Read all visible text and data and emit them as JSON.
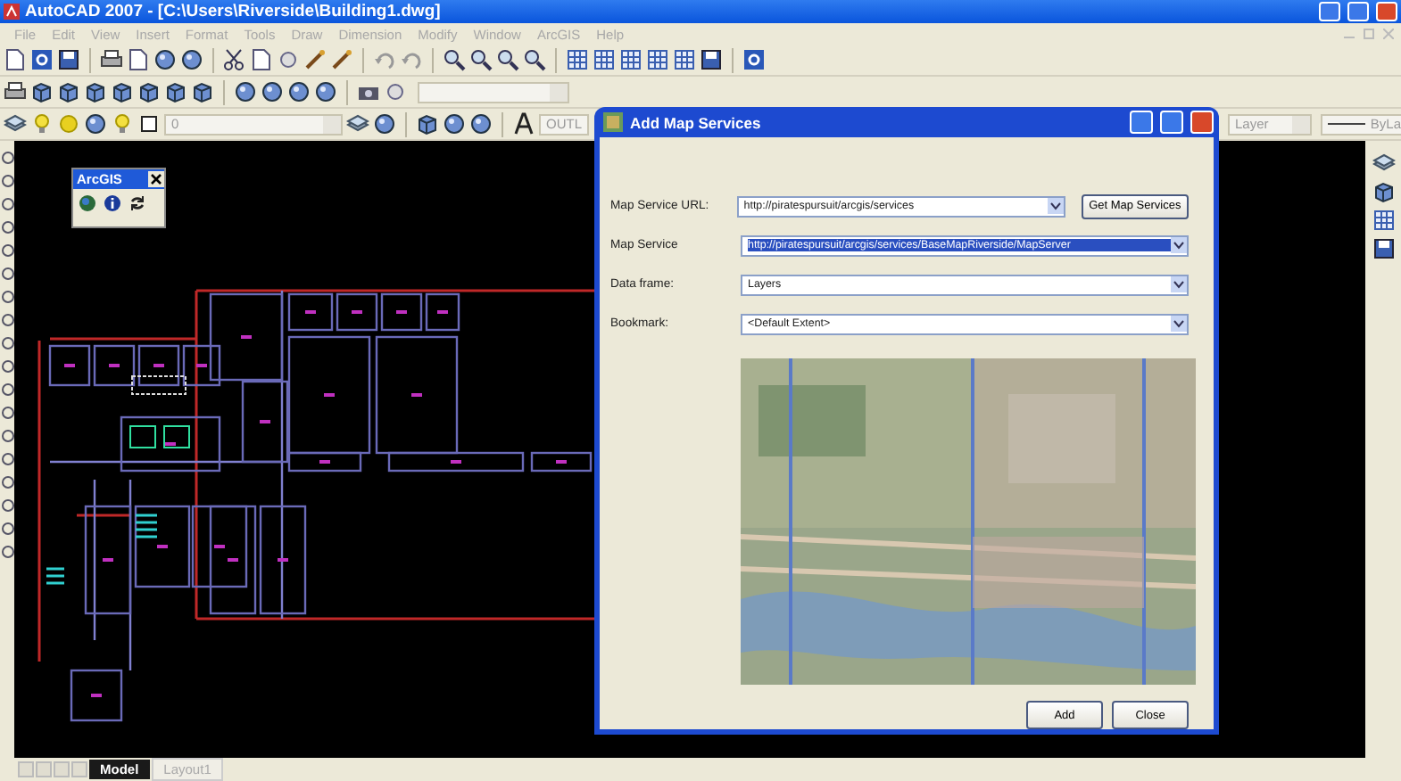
{
  "app_window": {
    "title": "AutoCAD 2007 - [C:\\Users\\Riverside\\Building1.dwg]"
  },
  "menu": [
    "File",
    "Edit",
    "View",
    "Insert",
    "Format",
    "Tools",
    "Draw",
    "Dimension",
    "Modify",
    "Window",
    "ArcGIS",
    "Help"
  ],
  "layer_toolbar": {
    "layer": "0",
    "text_style": "OUTL",
    "color_control": "Layer",
    "linetype_control": "ByLa"
  },
  "arcgis_toolbar": {
    "title": "ArcGIS"
  },
  "dialog": {
    "title": "Add Map Services",
    "fields": [
      {
        "label": "Map Service URL:",
        "value": "http://piratespursuit/arcgis/services",
        "selected": false
      },
      {
        "label": "Map Service",
        "value": "http://piratespursuit/arcgis/services/BaseMapRiverside/MapServer",
        "selected": true
      },
      {
        "label": "Data frame:",
        "value": "Layers",
        "selected": false
      },
      {
        "label": "Bookmark:",
        "value": "<Default Extent>",
        "selected": false
      }
    ],
    "get_button": "Get Map Services",
    "buttons": [
      "Add",
      "Close"
    ]
  },
  "layout_tabs": [
    {
      "label": "Model",
      "selected": true
    },
    {
      "label": "Layout1",
      "selected": false
    }
  ]
}
